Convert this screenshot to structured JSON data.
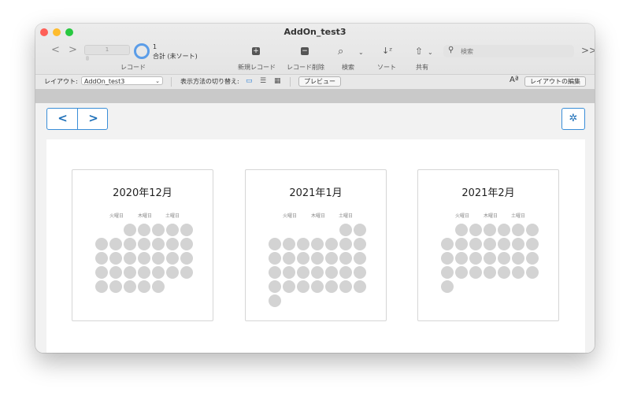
{
  "window": {
    "title": "AddOn_test3"
  },
  "toolbar": {
    "back_icon": "<",
    "forward_icon": ">",
    "record_slider_value": "1",
    "record_count": "1",
    "record_status": "合計 (未ソート)",
    "record_label": "レコード",
    "new_record_label": "新規レコード",
    "delete_record_label": "レコード削除",
    "find_label": "検索",
    "sort_label": "ソート",
    "share_label": "共有",
    "search_placeholder": "検索",
    "overflow_icon": ">>"
  },
  "layoutbar": {
    "layout_label": "レイアウト:",
    "layout_value": "AddOn_test3",
    "view_as_label": "表示方法の切り替え:",
    "preview_label": "プレビュー",
    "font_size_icon": "Aª",
    "edit_layout_label": "レイアウトの編集"
  },
  "content": {
    "prev_icon": "<",
    "next_icon": ">",
    "settings_icon": "gear"
  },
  "months": [
    {
      "title": "2020年12月",
      "weekdays": [
        "火曜日",
        "木曜日",
        "土曜日"
      ],
      "first_col": 2,
      "days": 31
    },
    {
      "title": "2021年1月",
      "weekdays": [
        "火曜日",
        "木曜日",
        "土曜日"
      ],
      "first_col": 5,
      "days": 31
    },
    {
      "title": "2021年2月",
      "weekdays": [
        "火曜日",
        "木曜日",
        "土曜日"
      ],
      "first_col": 1,
      "days": 28
    }
  ],
  "colors": {
    "accent": "#3a8ed8",
    "day_dot": "#d3d3d3"
  }
}
